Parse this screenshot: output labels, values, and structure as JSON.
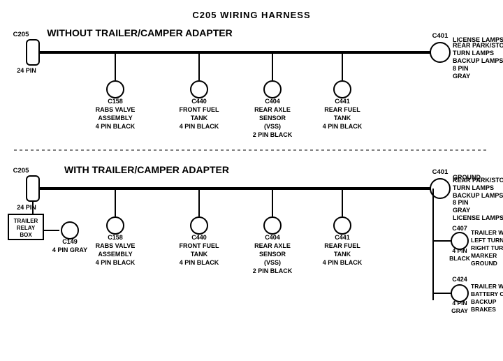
{
  "title": "C205 WIRING HARNESS",
  "section1": {
    "label": "WITHOUT TRAILER/CAMPER ADAPTER",
    "left_connector": {
      "id": "C205",
      "pin": "24 PIN"
    },
    "right_connector": {
      "id": "C401",
      "pin": "8 PIN",
      "color": "GRAY",
      "desc": "REAR PARK/STOP\nTURN LAMPS\nBACKUP LAMPS\nLICENSE LAMPS"
    },
    "sub_connectors": [
      {
        "id": "C158",
        "desc": "RABS VALVE\nASSEMBLY\n4 PIN BLACK"
      },
      {
        "id": "C440",
        "desc": "FRONT FUEL\nTANK\n4 PIN BLACK"
      },
      {
        "id": "C404",
        "desc": "REAR AXLE\nSENSOR\n(VSS)\n2 PIN BLACK"
      },
      {
        "id": "C441",
        "desc": "REAR FUEL\nTANK\n4 PIN BLACK"
      }
    ]
  },
  "section2": {
    "label": "WITH TRAILER/CAMPER ADAPTER",
    "left_connector": {
      "id": "C205",
      "pin": "24 PIN"
    },
    "right_connector": {
      "id": "C401",
      "pin": "8 PIN",
      "color": "GRAY",
      "desc": "REAR PARK/STOP\nTURN LAMPS\nBACKUP LAMPS\nLICENSE LAMPS\nGROUND"
    },
    "extra_left": {
      "box_label": "TRAILER\nRELAY\nBOX",
      "connector_id": "C149",
      "connector_pin": "4 PIN GRAY"
    },
    "sub_connectors": [
      {
        "id": "C158",
        "desc": "RABS VALVE\nASSEMBLY\n4 PIN BLACK"
      },
      {
        "id": "C440",
        "desc": "FRONT FUEL\nTANK\n4 PIN BLACK"
      },
      {
        "id": "C404",
        "desc": "REAR AXLE\nSENSOR\n(VSS)\n2 PIN BLACK"
      },
      {
        "id": "C441",
        "desc": "REAR FUEL\nTANK\n4 PIN BLACK"
      }
    ],
    "right_extra": [
      {
        "connector_id": "C407",
        "connector_pin": "4 PIN\nBLACK",
        "desc": "TRAILER WIRES\nLEFT TURN\nRIGHT TURN\nMARKER\nGROUND"
      },
      {
        "connector_id": "C424",
        "connector_pin": "4 PIN\nGRAY",
        "desc": "TRAILER WIRES\nBATTERY CHARGE\nBACKUP\nBRAKES"
      }
    ]
  }
}
